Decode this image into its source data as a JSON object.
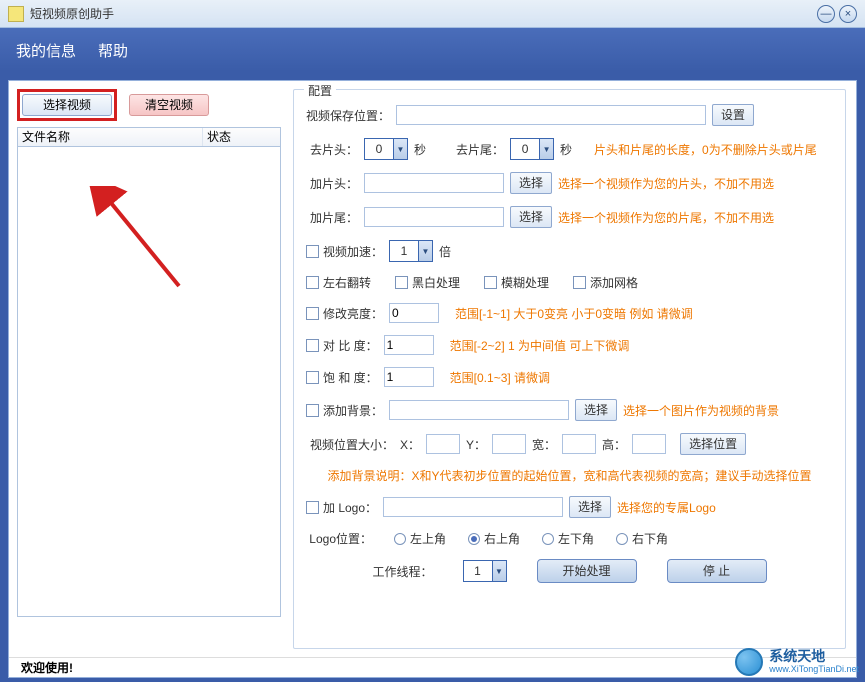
{
  "window": {
    "title": "短视频原创助手",
    "minimize": "—",
    "close": "×"
  },
  "menu": {
    "info": "我的信息",
    "help": "帮助"
  },
  "left": {
    "select_video": "选择视频",
    "clear_video": "清空视频",
    "col_filename": "文件名称",
    "col_status": "状态"
  },
  "config": {
    "legend": "配置",
    "save_path_label": "视频保存位置：",
    "save_path_value": "",
    "set_btn": "设置",
    "cut_head_label": "去片头：",
    "cut_head_value": "0",
    "sec1": "秒",
    "cut_tail_label": "去片尾：",
    "cut_tail_value": "0",
    "sec2": "秒",
    "cut_hint": "片头和片尾的长度，0为不删除片头或片尾",
    "add_head_label": "加片头：",
    "add_head_value": "",
    "choose": "选择",
    "add_head_hint": "选择一个视频作为您的片头，不加不用选",
    "add_tail_label": "加片尾：",
    "add_tail_value": "",
    "add_tail_hint": "选择一个视频作为您的片尾，不加不用选",
    "accel_label": "视频加速：",
    "accel_value": "1",
    "accel_suffix": "倍",
    "flip_label": "左右翻转",
    "bw_label": "黑白处理",
    "blur_label": "模糊处理",
    "grid_label": "添加网格",
    "brightness_cb": "修改亮度：",
    "brightness_value": "0",
    "brightness_hint": "范围[-1~1]   大于0变亮 小于0变暗  例如 请微调",
    "contrast_cb": "对 比  度：",
    "contrast_value": "1",
    "contrast_hint": "范围[-2~2]  1 为中间值  可上下微调",
    "saturation_cb": "饱 和  度：",
    "saturation_value": "1",
    "saturation_hint": "范围[0.1~3]   请微调",
    "bg_cb": "添加背景：",
    "bg_value": "",
    "bg_hint": "选择一个图片作为视频的背景",
    "pos_label": "视频位置大小：",
    "pos_x": "X：",
    "pos_y": "Y：",
    "pos_w": "宽：",
    "pos_h": "高：",
    "pos_btn": "选择位置",
    "bg_note": "添加背景说明：X和Y代表初步位置的起始位置，宽和高代表视频的宽高；建议手动选择位置",
    "logo_cb": "加 Logo：",
    "logo_value": "",
    "logo_hint": "选择您的专属Logo",
    "logo_pos_label": "Logo位置：",
    "logo_tl": "左上角",
    "logo_tr": "右上角",
    "logo_bl": "左下角",
    "logo_br": "右下角",
    "threads_label": "工作线程：",
    "threads_value": "1",
    "start_btn": "开始处理",
    "stop_btn": "停   止"
  },
  "footer": {
    "welcome": "欢迎使用!"
  },
  "watermark": {
    "line1": "系统天地",
    "line2": "www.XiTongTianDi.net"
  }
}
